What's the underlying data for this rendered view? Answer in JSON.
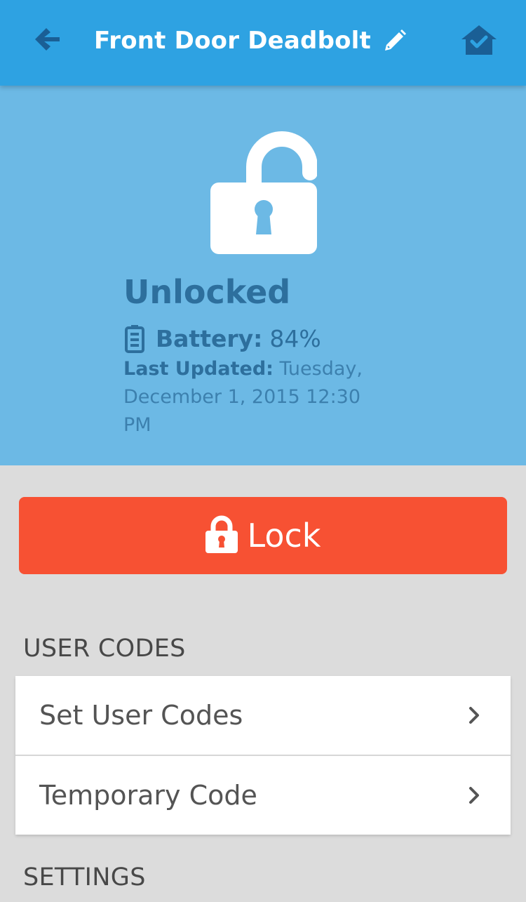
{
  "header": {
    "title": "Front Door Deadbolt"
  },
  "status": {
    "state": "Unlocked",
    "battery_label": "Battery:",
    "battery_value": "84%",
    "updated_label": "Last Updated:",
    "updated_value": " Tuesday, December 1, 2015 12:30 PM"
  },
  "action": {
    "lock_label": "Lock"
  },
  "sections": {
    "user_codes": "USER CODES",
    "settings": "SETTINGS"
  },
  "user_codes_items": [
    {
      "label": "Set User Codes"
    },
    {
      "label": "Temporary Code"
    }
  ],
  "colors": {
    "header": "#2ea2e2",
    "status_panel": "#6cb9e5",
    "lock_button": "#f75133",
    "background": "#dcdcdc"
  },
  "icons": {
    "back": "arrow-left-icon",
    "edit": "pencil-icon",
    "home": "home-check-icon",
    "state": "lock-open-icon",
    "battery": "battery-icon",
    "lock_action": "lock-closed-icon",
    "row_chevron": "chevron-right-icon"
  }
}
